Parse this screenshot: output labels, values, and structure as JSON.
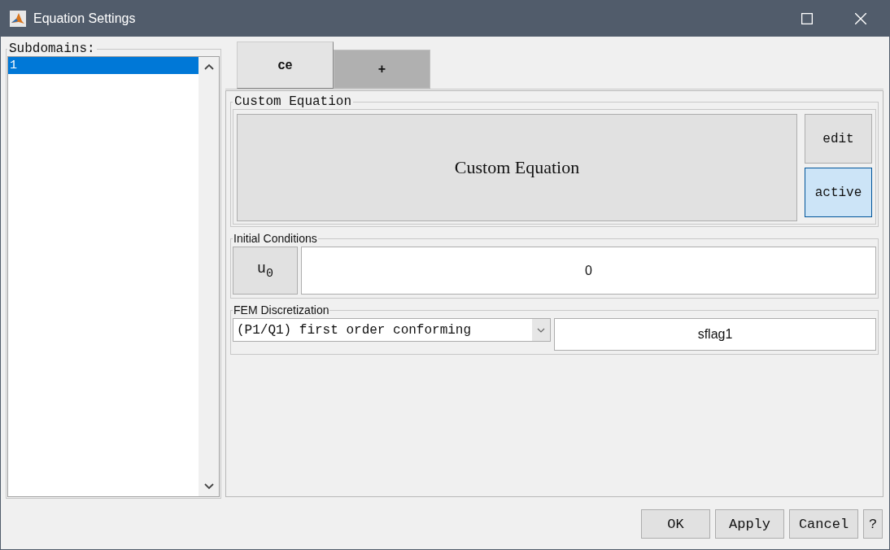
{
  "window": {
    "title": "Equation Settings"
  },
  "subdomains": {
    "label": "Subdomains:",
    "items": [
      {
        "label": "1",
        "selected": true
      }
    ]
  },
  "tabs": [
    {
      "label": "ce",
      "selected": true
    },
    {
      "label": "+",
      "selected": false
    }
  ],
  "custom_equation": {
    "legend": "Custom Equation",
    "equation": "Custom Equation",
    "buttons": [
      {
        "label": "edit",
        "on": false
      },
      {
        "label": "active",
        "on": true
      }
    ]
  },
  "initial_conditions": {
    "legend": "Initial Conditions",
    "variable": "u$_{0}$",
    "value": "0"
  },
  "fem": {
    "legend": "FEM Discretization",
    "selection": "(P1/Q1) first order conforming",
    "flag": "sflag1"
  },
  "buttons": [
    "OK",
    "Apply",
    "Cancel",
    "?"
  ]
}
